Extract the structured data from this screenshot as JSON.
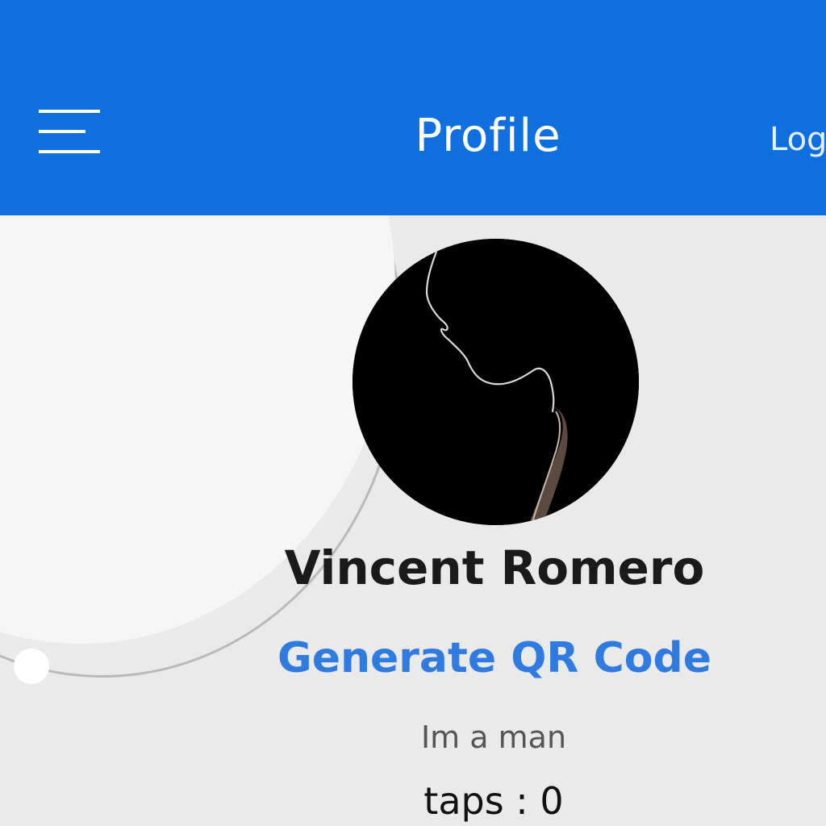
{
  "header": {
    "title": "Profile",
    "menu_icon": "hamburger-menu-icon",
    "logout_label": "Log"
  },
  "profile": {
    "avatar_description_icon": "profile-silhouette-photo",
    "name": "Vincent Romero",
    "qr_button_label": "Generate QR Code",
    "bio": "Im a man",
    "taps_label": "taps : 0"
  },
  "colors": {
    "header_bg": "#0f6fde",
    "link": "#2f7be0",
    "page_bg": "#eaeaea"
  }
}
